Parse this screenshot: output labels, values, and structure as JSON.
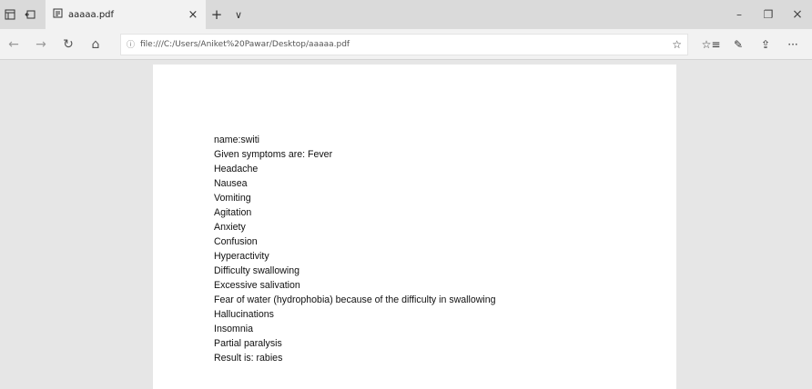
{
  "tabbar": {
    "tab": {
      "title": "aaaaa.pdf",
      "close": "×"
    },
    "new_tab": "+",
    "tab_menu": "∨",
    "minimize": "–",
    "restore": "❐",
    "close": "×"
  },
  "navbar": {
    "back": "←",
    "forward": "→",
    "refresh": "↻",
    "home": "⌂",
    "url": "file:///C:/Users/Aniket%20Pawar/Desktop/aaaaa.pdf",
    "favorite": "☆",
    "favorites_bar": "☆≡",
    "notes": "✎",
    "share": "⇪",
    "more": "···"
  },
  "document": {
    "lines": [
      "name:switi",
      "Given symptoms are: Fever",
      "Headache",
      "Nausea",
      "Vomiting",
      "Agitation",
      "Anxiety",
      "Confusion",
      "Hyperactivity",
      "Difficulty swallowing",
      "Excessive salivation",
      "Fear of water (hydrophobia) because of the difficulty in swallowing",
      "Hallucinations",
      "Insomnia",
      "Partial paralysis",
      "Result is: rabies"
    ]
  }
}
